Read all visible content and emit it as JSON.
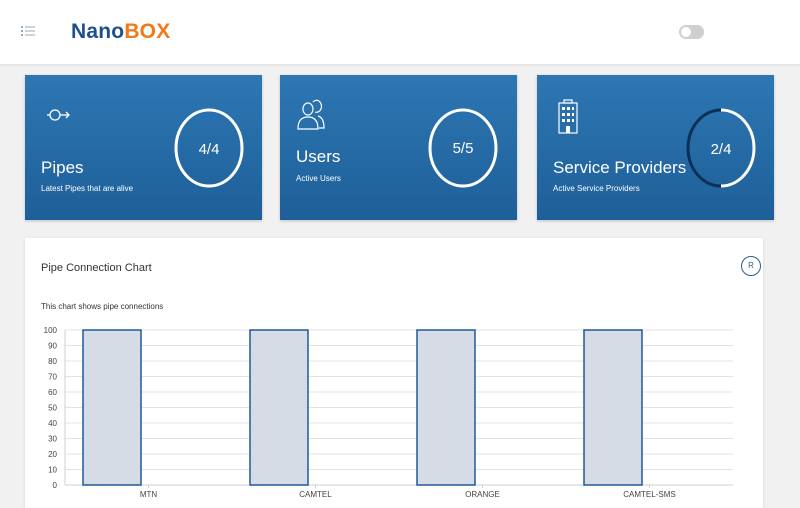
{
  "header": {
    "brand_part1": "Nano",
    "brand_part2": "BOX",
    "menu_icon": "list-icon",
    "toggle_state": "off"
  },
  "cards": [
    {
      "title": "Pipes",
      "subtitle": "Latest Pipes that are alive",
      "value": "4/4",
      "icon": "pipe-arrow-icon",
      "fraction": 1.0
    },
    {
      "title": "Users",
      "subtitle": "Active Users",
      "value": "5/5",
      "icon": "users-icon",
      "fraction": 1.0
    },
    {
      "title": "Service Providers",
      "subtitle": "Active Service Providers",
      "value": "2/4",
      "icon": "building-icon",
      "fraction": 0.5
    }
  ],
  "chart_panel": {
    "title": "Pipe Connection Chart",
    "description": "This chart shows pipe connections",
    "reset_label": "R"
  },
  "chart_data": {
    "type": "bar",
    "categories": [
      "MTN",
      "CAMTEL",
      "ORANGE",
      "CAMTEL-SMS"
    ],
    "values": [
      100,
      100,
      100,
      100
    ],
    "ylim": [
      0,
      100
    ],
    "yticks": [
      0,
      10,
      20,
      30,
      40,
      50,
      60,
      70,
      80,
      90,
      100
    ],
    "grid": true,
    "bar_fill": "#d5dce6",
    "bar_stroke": "#1f5a99"
  },
  "colors": {
    "card_top": "#2d77b3",
    "card_bottom": "#1e5f99",
    "brand_blue": "#1f4f8c",
    "brand_orange": "#f07a1a",
    "ring_track": "#0d2f55"
  }
}
